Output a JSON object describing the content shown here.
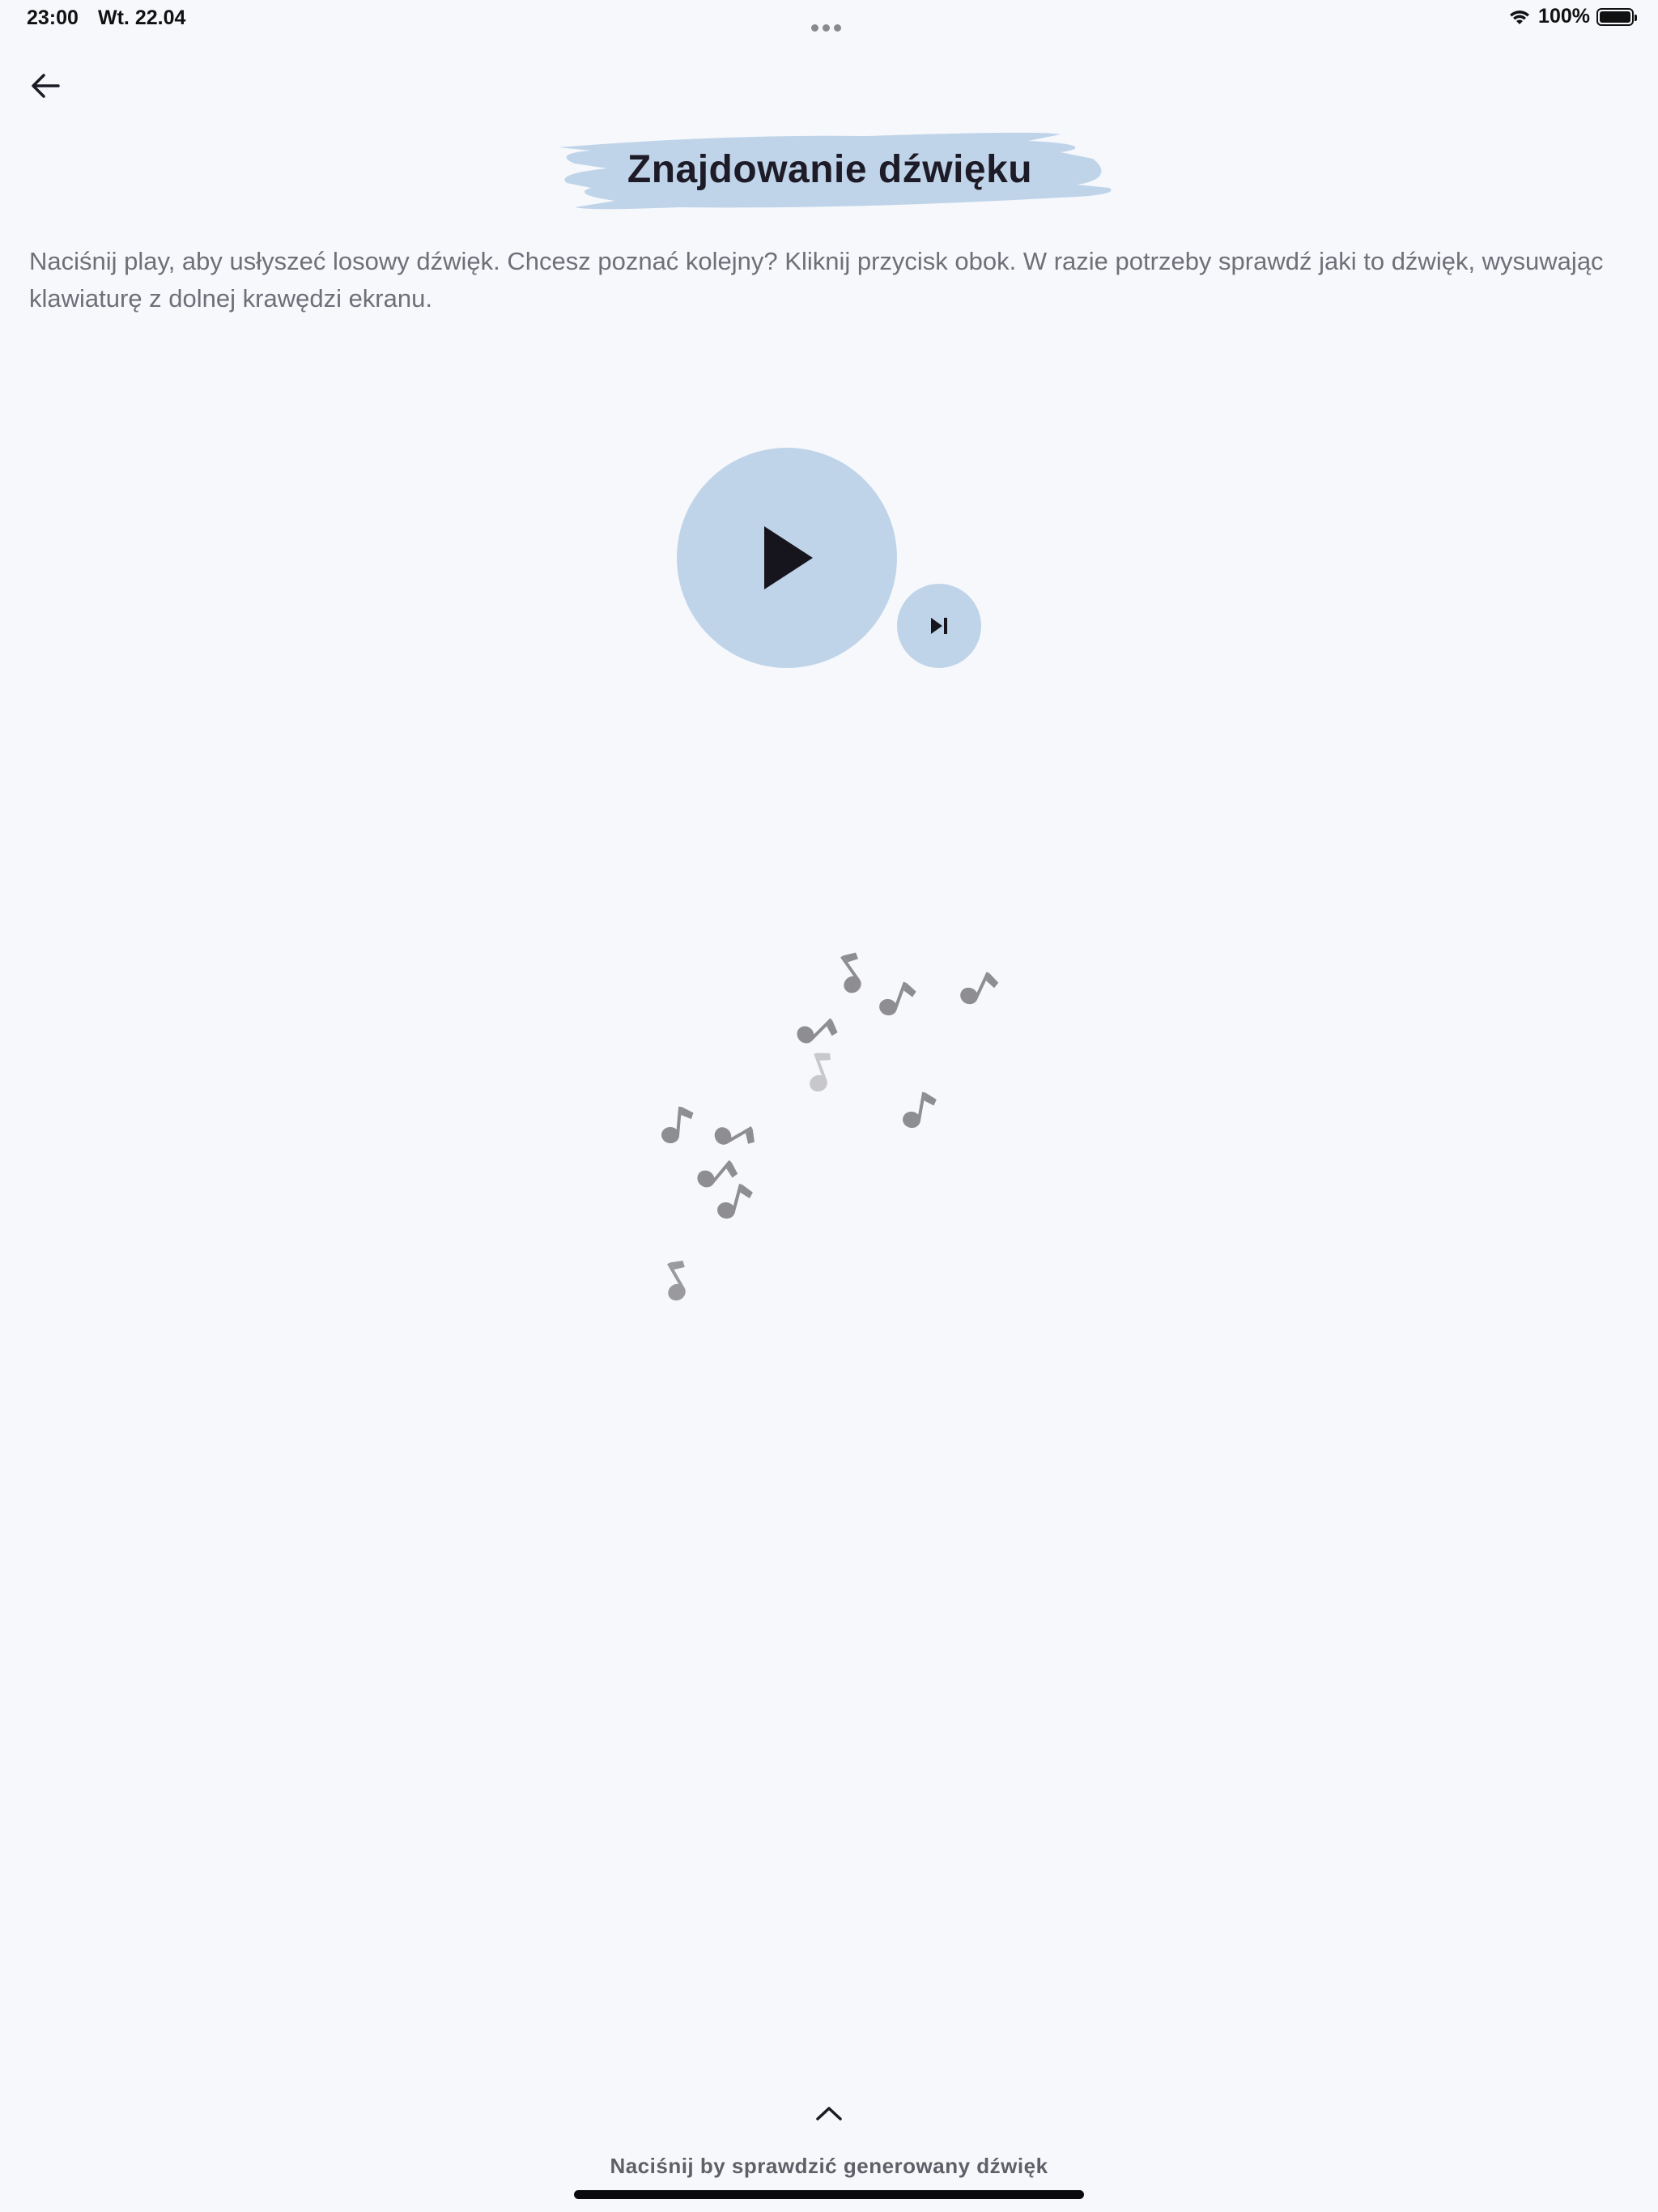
{
  "status_bar": {
    "time": "23:00",
    "date": "Wt. 22.04",
    "battery": "100%",
    "icons": [
      "more-dots-icon",
      "wifi-icon",
      "battery-icon"
    ]
  },
  "header": {
    "back_icon": "arrow-left-icon",
    "title": "Znajdowanie dźwięku",
    "title_highlight_color": "#c0d4e9"
  },
  "instructions": "Naciśnij play, aby usłyszeć losowy dźwięk. Chcesz poznać kolejny? Kliknij przycisk obok.   W razie potrzeby sprawdź jaki to dźwięk, wysuwając klawiaturę z dolnej krawędzi ekranu.",
  "player": {
    "play_icon": "play-icon",
    "next_icon": "skip-next-icon",
    "button_color": "#c0d4e9",
    "decoration_icon": "music-note-icon"
  },
  "keyboard_drawer": {
    "expand_icon": "chevron-up-icon",
    "hint": "Naciśnij by sprawdzić generowany dźwięk"
  }
}
